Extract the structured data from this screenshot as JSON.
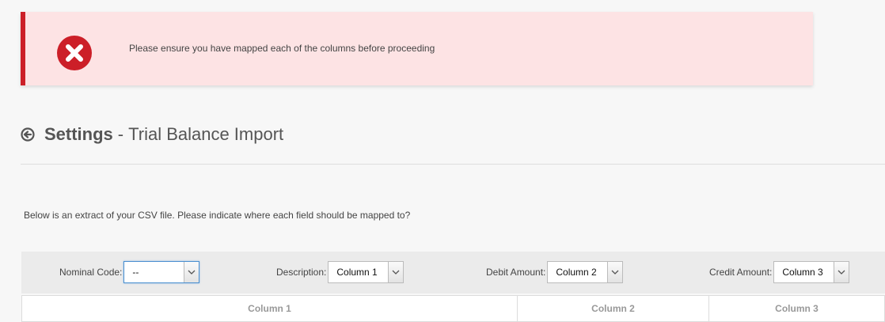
{
  "alert": {
    "icon": "error-x-icon",
    "color": "#cc1f28",
    "message": "Please ensure you have mapped each of the columns before proceeding"
  },
  "header": {
    "back_icon": "back-circle-arrow-icon",
    "title": "Settings",
    "separator": "-",
    "subtitle": "Trial Balance Import"
  },
  "intro": "Below is an extract of your CSV file. Please indicate where each field should be mapped to?",
  "mapping": [
    {
      "label": "Nominal Code:",
      "value": "--"
    },
    {
      "label": "Description:",
      "value": "Column 1"
    },
    {
      "label": "Debit Amount:",
      "value": "Column 2"
    },
    {
      "label": "Credit Amount:",
      "value": "Column 3"
    }
  ],
  "table": {
    "headers": [
      "Column 1",
      "Column 2",
      "Column 3"
    ]
  }
}
